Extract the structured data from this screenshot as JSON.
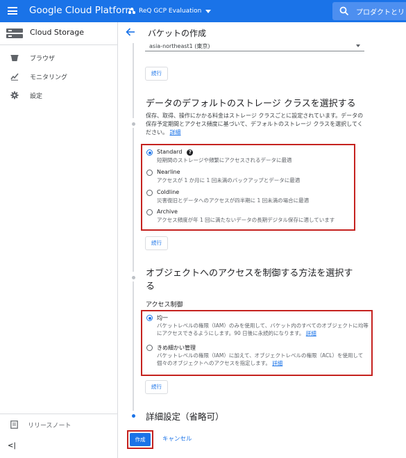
{
  "header": {
    "app_title": "Google Cloud Platform",
    "project_name": "ReQ GCP Evaluation",
    "search_placeholder": "プロダクトとリ"
  },
  "sidebar": {
    "title": "Cloud Storage",
    "items": [
      {
        "label": "ブラウザ",
        "icon": "bucket-icon"
      },
      {
        "label": "モニタリング",
        "icon": "chart-icon"
      },
      {
        "label": "設定",
        "icon": "gear-icon"
      }
    ],
    "release_notes": "リリースノート",
    "collapse": "<|"
  },
  "main": {
    "title": "バケットの作成",
    "location_value": "asia-northeast1 (東京)",
    "continue_label": "続行",
    "storage_class": {
      "title": "データのデフォルトのストレージ クラスを選択する",
      "description": "保存、取得、操作にかかる料金はストレージ クラスごとに設定されています。データの保存予定期間とアクセス頻度に基づいて、デフォルトのストレージ クラスを選択してください。",
      "details_link": "詳細",
      "options": [
        {
          "label": "Standard",
          "desc": "短期間のストレージや頻繁にアクセスされるデータに最適",
          "checked": true
        },
        {
          "label": "Nearline",
          "desc": "アクセスが 1 か月に 1 回未満のバックアップとデータに最適",
          "checked": false
        },
        {
          "label": "Coldline",
          "desc": "災害復旧とデータへのアクセスが四半期に 1 回未満の場合に最適",
          "checked": false
        },
        {
          "label": "Archive",
          "desc": "アクセス頻度が年 1 回に満たないデータの長期デジタル保存に適しています",
          "checked": false
        }
      ]
    },
    "access": {
      "title_line1": "オブジェクトへのアクセスを制御する方法を選択す",
      "title_line2": "る",
      "subheading": "アクセス制御",
      "options": [
        {
          "label": "均一",
          "desc": "バケットレベルの権限（IAM）のみを使用して、バケット内のすべてのオブジェクトに均等にアクセスできるようにします。90 日後に永続的になります。",
          "link": "詳細",
          "checked": true
        },
        {
          "label": "きめ細かい管理",
          "desc": "バケットレベルの権限（IAM）に加えて、オブジェクトレベルの権限（ACL）を使用して個々のオブジェクトへのアクセスを指定します。",
          "link": "詳細",
          "checked": false
        }
      ]
    },
    "advanced": {
      "title": "詳細設定（省略可）"
    },
    "create_label": "作成",
    "cancel_label": "キャンセル"
  },
  "colors": {
    "primary": "#1a73e8",
    "highlight_border": "#c5221f"
  }
}
